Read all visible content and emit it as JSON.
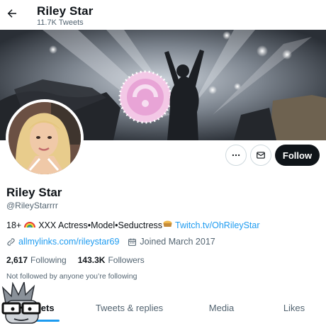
{
  "header": {
    "name": "Riley Star",
    "tweet_count": "11.7K Tweets"
  },
  "profile": {
    "name": "Riley Star",
    "handle": "@RileyStarrrr",
    "bio_text": "18+ ",
    "bio_middle": " XXX Actress•Model•Seductress",
    "bio_link": "Twitch.tv/OhRileyStar",
    "website": "allmylinks.com/rileystar69",
    "joined": "Joined March 2017",
    "following_count": "2,617",
    "following_label": "Following",
    "followers_count": "143.3K",
    "followers_label": "Followers",
    "not_followed": "Not followed by anyone you’re following"
  },
  "actions": {
    "follow_label": "Follow"
  },
  "tabs": [
    {
      "label": "Tweets"
    },
    {
      "label": "Tweets & replies"
    },
    {
      "label": "Media"
    },
    {
      "label": "Likes"
    }
  ],
  "colors": {
    "accent": "#1d9bf0",
    "text": "#0f1419",
    "muted": "#536471",
    "follow_bg": "#0f1419"
  },
  "icons": [
    "back-arrow-icon",
    "more-icon",
    "mail-icon",
    "link-icon",
    "calendar-icon",
    "rainbow-icon",
    "pie-icon"
  ]
}
